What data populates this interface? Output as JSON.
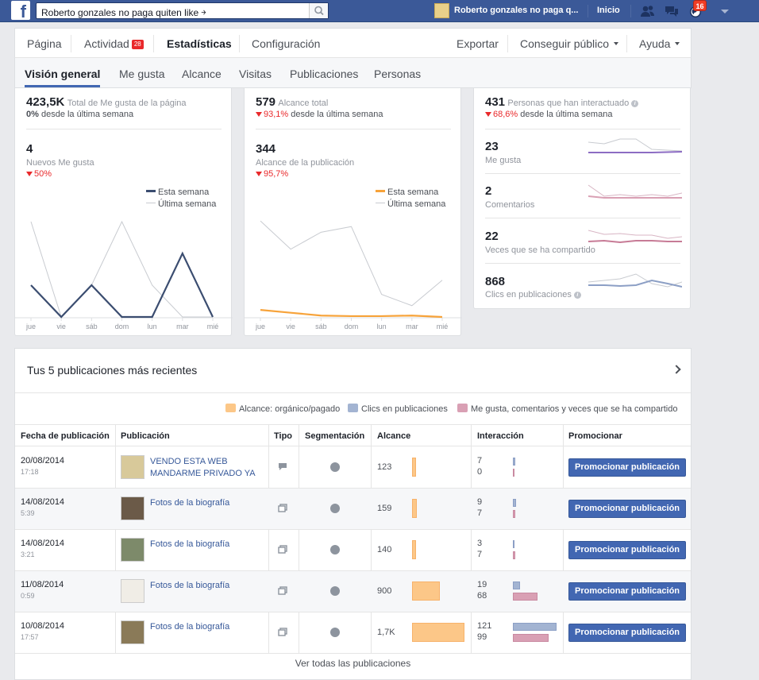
{
  "topbar": {
    "logo": "f",
    "search_value": "Roberto gonzales no paga quiten like  ￫",
    "profile_name": "Roberto gonzales no paga q...",
    "home": "Inicio",
    "notifications": "16"
  },
  "nav": {
    "pagina": "Página",
    "actividad": "Actividad",
    "actividad_badge": "28",
    "estadisticas": "Estadísticas",
    "configuracion": "Configuración",
    "exportar": "Exportar",
    "conseguir": "Conseguir público",
    "ayuda": "Ayuda"
  },
  "tabs": [
    "Visión general",
    "Me gusta",
    "Alcance",
    "Visitas",
    "Publicaciones",
    "Personas"
  ],
  "likes_card": {
    "total": "423,5K",
    "total_label": "Total de Me gusta de la página",
    "total_delta": "0%",
    "total_delta_suffix": " desde la última semana",
    "new": "4",
    "new_label": "Nuevos Me gusta",
    "new_delta": "50%",
    "legend_this": "Esta semana",
    "legend_last": "Última semana"
  },
  "reach_card": {
    "total": "579",
    "total_label": "Alcance total",
    "total_delta": "93,1%",
    "total_delta_suffix": " desde la última semana",
    "post": "344",
    "post_label": "Alcance de la publicación",
    "post_delta": "95,7%",
    "legend_this": "Esta semana",
    "legend_last": "Última semana"
  },
  "engage_card": {
    "total": "431",
    "total_label": "Personas que han interactuado",
    "total_delta": "68,6%",
    "total_delta_suffix": " desde la última semana",
    "items": [
      {
        "value": "23",
        "label": "Me gusta"
      },
      {
        "value": "2",
        "label": "Comentarios"
      },
      {
        "value": "22",
        "label": "Veces que se ha compartido"
      },
      {
        "value": "868",
        "label": "Clics en publicaciones"
      }
    ]
  },
  "chart_data": [
    {
      "type": "line",
      "categories": [
        "jue",
        "vie",
        "sáb",
        "dom",
        "lun",
        "mar",
        "mié"
      ],
      "series": [
        {
          "name": "Esta semana",
          "values": [
            1,
            0,
            1,
            0,
            0,
            2,
            0
          ],
          "color": "#3b4d70"
        },
        {
          "name": "Última semana",
          "values": [
            3,
            0,
            1,
            3,
            1,
            0,
            0
          ],
          "color": "#c8cbd0"
        }
      ],
      "ylim": [
        0,
        3.2
      ]
    },
    {
      "type": "line",
      "categories": [
        "jue",
        "vie",
        "sáb",
        "dom",
        "lun",
        "mar",
        "mié"
      ],
      "series": [
        {
          "name": "Esta semana",
          "values": [
            25,
            15,
            5,
            3,
            3,
            5,
            0
          ],
          "color": "#f7a33a"
        },
        {
          "name": "Última semana",
          "values": [
            340,
            240,
            300,
            320,
            80,
            40,
            130
          ],
          "color": "#c8cbd0"
        }
      ],
      "ylim": [
        0,
        360
      ]
    }
  ],
  "posts": {
    "title": "Tus 5 publicaciones más recientes",
    "legend": [
      "Alcance: orgánico/pagado",
      "Clics en publicaciones",
      "Me gusta, comentarios y veces que se ha compartido"
    ],
    "colors": {
      "reach": "#fcc788",
      "clicks": "#a3b4d2",
      "likes": "#d9a0b4"
    },
    "headers": [
      "Fecha de publicación",
      "Publicación",
      "Tipo",
      "Segmentación",
      "Alcance",
      "Interacción",
      "Promocionar"
    ],
    "promote_label": "Promocionar publicación",
    "view_all": "Ver todas las publicaciones",
    "rows": [
      {
        "date": "20/08/2014",
        "time": "17:18",
        "title": "VENDO ESTA WEB MANDARME PRIVADO YA",
        "type_icon": "comment-icon",
        "reach": "123",
        "clicks": "7",
        "likes": "0"
      },
      {
        "date": "14/08/2014",
        "time": "5:39",
        "title": "Fotos de la biografía",
        "type_icon": "album-icon",
        "reach": "159",
        "clicks": "9",
        "likes": "7"
      },
      {
        "date": "14/08/2014",
        "time": "3:21",
        "title": "Fotos de la biografía",
        "type_icon": "album-icon",
        "reach": "140",
        "clicks": "3",
        "likes": "7"
      },
      {
        "date": "11/08/2014",
        "time": "0:59",
        "title": "Fotos de la biografía",
        "type_icon": "album-icon",
        "reach": "900",
        "clicks": "19",
        "likes": "68"
      },
      {
        "date": "10/08/2014",
        "time": "17:57",
        "title": "Fotos de la biografía",
        "type_icon": "album-icon",
        "reach": "1,7K",
        "clicks": "121",
        "likes": "99"
      }
    ]
  }
}
